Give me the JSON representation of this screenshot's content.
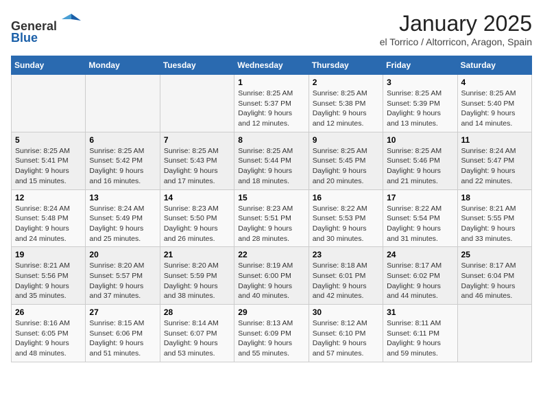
{
  "header": {
    "logo_line1": "General",
    "logo_line2": "Blue",
    "title": "January 2025",
    "subtitle": "el Torrico / Altorricon, Aragon, Spain"
  },
  "weekdays": [
    "Sunday",
    "Monday",
    "Tuesday",
    "Wednesday",
    "Thursday",
    "Friday",
    "Saturday"
  ],
  "weeks": [
    [
      {
        "day": "",
        "info": ""
      },
      {
        "day": "",
        "info": ""
      },
      {
        "day": "",
        "info": ""
      },
      {
        "day": "1",
        "info": "Sunrise: 8:25 AM\nSunset: 5:37 PM\nDaylight: 9 hours and 12 minutes."
      },
      {
        "day": "2",
        "info": "Sunrise: 8:25 AM\nSunset: 5:38 PM\nDaylight: 9 hours and 12 minutes."
      },
      {
        "day": "3",
        "info": "Sunrise: 8:25 AM\nSunset: 5:39 PM\nDaylight: 9 hours and 13 minutes."
      },
      {
        "day": "4",
        "info": "Sunrise: 8:25 AM\nSunset: 5:40 PM\nDaylight: 9 hours and 14 minutes."
      }
    ],
    [
      {
        "day": "5",
        "info": "Sunrise: 8:25 AM\nSunset: 5:41 PM\nDaylight: 9 hours and 15 minutes."
      },
      {
        "day": "6",
        "info": "Sunrise: 8:25 AM\nSunset: 5:42 PM\nDaylight: 9 hours and 16 minutes."
      },
      {
        "day": "7",
        "info": "Sunrise: 8:25 AM\nSunset: 5:43 PM\nDaylight: 9 hours and 17 minutes."
      },
      {
        "day": "8",
        "info": "Sunrise: 8:25 AM\nSunset: 5:44 PM\nDaylight: 9 hours and 18 minutes."
      },
      {
        "day": "9",
        "info": "Sunrise: 8:25 AM\nSunset: 5:45 PM\nDaylight: 9 hours and 20 minutes."
      },
      {
        "day": "10",
        "info": "Sunrise: 8:25 AM\nSunset: 5:46 PM\nDaylight: 9 hours and 21 minutes."
      },
      {
        "day": "11",
        "info": "Sunrise: 8:24 AM\nSunset: 5:47 PM\nDaylight: 9 hours and 22 minutes."
      }
    ],
    [
      {
        "day": "12",
        "info": "Sunrise: 8:24 AM\nSunset: 5:48 PM\nDaylight: 9 hours and 24 minutes."
      },
      {
        "day": "13",
        "info": "Sunrise: 8:24 AM\nSunset: 5:49 PM\nDaylight: 9 hours and 25 minutes."
      },
      {
        "day": "14",
        "info": "Sunrise: 8:23 AM\nSunset: 5:50 PM\nDaylight: 9 hours and 26 minutes."
      },
      {
        "day": "15",
        "info": "Sunrise: 8:23 AM\nSunset: 5:51 PM\nDaylight: 9 hours and 28 minutes."
      },
      {
        "day": "16",
        "info": "Sunrise: 8:22 AM\nSunset: 5:53 PM\nDaylight: 9 hours and 30 minutes."
      },
      {
        "day": "17",
        "info": "Sunrise: 8:22 AM\nSunset: 5:54 PM\nDaylight: 9 hours and 31 minutes."
      },
      {
        "day": "18",
        "info": "Sunrise: 8:21 AM\nSunset: 5:55 PM\nDaylight: 9 hours and 33 minutes."
      }
    ],
    [
      {
        "day": "19",
        "info": "Sunrise: 8:21 AM\nSunset: 5:56 PM\nDaylight: 9 hours and 35 minutes."
      },
      {
        "day": "20",
        "info": "Sunrise: 8:20 AM\nSunset: 5:57 PM\nDaylight: 9 hours and 37 minutes."
      },
      {
        "day": "21",
        "info": "Sunrise: 8:20 AM\nSunset: 5:59 PM\nDaylight: 9 hours and 38 minutes."
      },
      {
        "day": "22",
        "info": "Sunrise: 8:19 AM\nSunset: 6:00 PM\nDaylight: 9 hours and 40 minutes."
      },
      {
        "day": "23",
        "info": "Sunrise: 8:18 AM\nSunset: 6:01 PM\nDaylight: 9 hours and 42 minutes."
      },
      {
        "day": "24",
        "info": "Sunrise: 8:17 AM\nSunset: 6:02 PM\nDaylight: 9 hours and 44 minutes."
      },
      {
        "day": "25",
        "info": "Sunrise: 8:17 AM\nSunset: 6:04 PM\nDaylight: 9 hours and 46 minutes."
      }
    ],
    [
      {
        "day": "26",
        "info": "Sunrise: 8:16 AM\nSunset: 6:05 PM\nDaylight: 9 hours and 48 minutes."
      },
      {
        "day": "27",
        "info": "Sunrise: 8:15 AM\nSunset: 6:06 PM\nDaylight: 9 hours and 51 minutes."
      },
      {
        "day": "28",
        "info": "Sunrise: 8:14 AM\nSunset: 6:07 PM\nDaylight: 9 hours and 53 minutes."
      },
      {
        "day": "29",
        "info": "Sunrise: 8:13 AM\nSunset: 6:09 PM\nDaylight: 9 hours and 55 minutes."
      },
      {
        "day": "30",
        "info": "Sunrise: 8:12 AM\nSunset: 6:10 PM\nDaylight: 9 hours and 57 minutes."
      },
      {
        "day": "31",
        "info": "Sunrise: 8:11 AM\nSunset: 6:11 PM\nDaylight: 9 hours and 59 minutes."
      },
      {
        "day": "",
        "info": ""
      }
    ]
  ]
}
